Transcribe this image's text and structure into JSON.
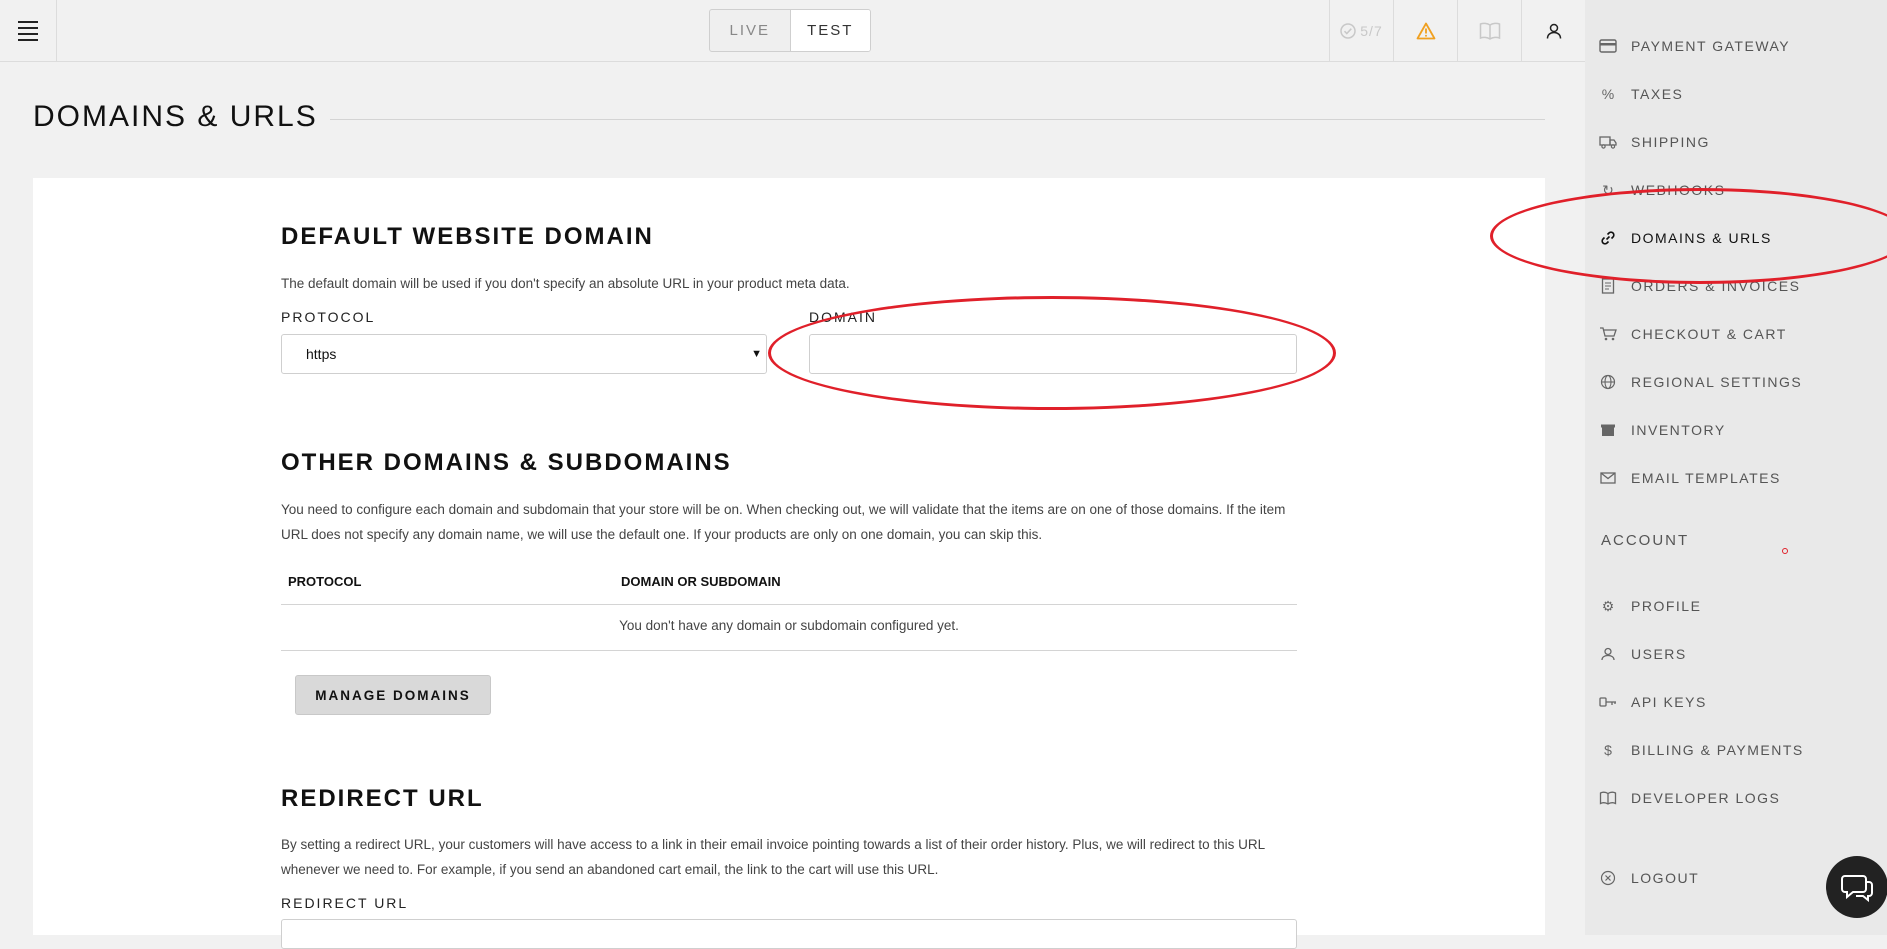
{
  "topbar": {
    "mode_live": "LIVE",
    "mode_test": "TEST",
    "progress": "5/7"
  },
  "page_title": "DOMAINS & URLS",
  "default_domain": {
    "title": "DEFAULT WEBSITE DOMAIN",
    "description": "The default domain will be used if you don't specify an absolute URL in your product meta data.",
    "protocol_label": "PROTOCOL",
    "protocol_value": "https",
    "domain_label": "DOMAIN",
    "domain_value": ""
  },
  "other_domains": {
    "title": "OTHER DOMAINS & SUBDOMAINS",
    "description": "You need to configure each domain and subdomain that your store will be on. When checking out, we will validate that the items are on one of those domains. If the item URL does not specify any domain name, we will use the default one. If your products are only on one domain, you can skip this.",
    "col_protocol": "PROTOCOL",
    "col_domain": "DOMAIN OR SUBDOMAIN",
    "empty_text": "You don't have any domain or subdomain configured yet.",
    "manage_button": "MANAGE DOMAINS"
  },
  "redirect": {
    "title": "REDIRECT URL",
    "description": "By setting a redirect URL, your customers will have access to a link in their email invoice pointing towards a list of their order history. Plus, we will redirect to this URL whenever we need to. For example, if you send an abandoned cart email, the link to the cart will use this URL.",
    "label": "REDIRECT URL"
  },
  "sidebar": {
    "items": [
      {
        "label": "PAYMENT GATEWAY",
        "icon": "credit-card-icon"
      },
      {
        "label": "TAXES",
        "icon": "percent-icon"
      },
      {
        "label": "SHIPPING",
        "icon": "truck-icon"
      },
      {
        "label": "WEBHOOKS",
        "icon": "webhook-icon"
      },
      {
        "label": "DOMAINS & URLS",
        "icon": "link-icon"
      },
      {
        "label": "ORDERS & INVOICES",
        "icon": "invoice-icon"
      },
      {
        "label": "CHECKOUT & CART",
        "icon": "cart-icon"
      },
      {
        "label": "REGIONAL SETTINGS",
        "icon": "globe-icon"
      },
      {
        "label": "INVENTORY",
        "icon": "box-icon"
      },
      {
        "label": "EMAIL TEMPLATES",
        "icon": "envelope-icon"
      }
    ],
    "account_heading": "ACCOUNT",
    "account_items": [
      {
        "label": "PROFILE",
        "icon": "gear-icon"
      },
      {
        "label": "USERS",
        "icon": "users-icon"
      },
      {
        "label": "API KEYS",
        "icon": "key-icon"
      },
      {
        "label": "BILLING & PAYMENTS",
        "icon": "dollar-icon"
      },
      {
        "label": "DEVELOPER LOGS",
        "icon": "book-icon"
      }
    ],
    "logout": "LOGOUT"
  },
  "colors": {
    "annotation": "#e0202a",
    "warning": "#f0a020"
  }
}
